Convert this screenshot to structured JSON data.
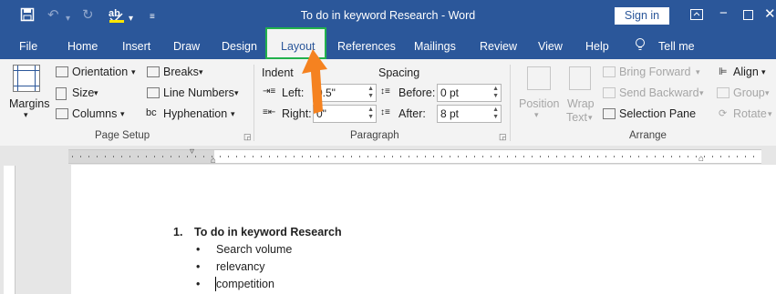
{
  "window": {
    "title": "To do in keyword Research  -  Word",
    "signin_label": "Sign in"
  },
  "tabs": [
    "File",
    "Home",
    "Insert",
    "Draw",
    "Design",
    "Layout",
    "References",
    "Mailings",
    "Review",
    "View",
    "Help",
    "Tell me"
  ],
  "active_tab": "Layout",
  "page_setup": {
    "margins": "Margins",
    "orientation": "Orientation",
    "size": "Size",
    "columns": "Columns",
    "breaks": "Breaks",
    "line_numbers": "Line Numbers",
    "hyphenation": "Hyphenation",
    "group_label": "Page Setup"
  },
  "paragraph": {
    "indent_label": "Indent",
    "spacing_label": "Spacing",
    "left_label": "Left:",
    "left_value": "0.5\"",
    "right_label": "Right:",
    "right_value": "0\"",
    "before_label": "Before:",
    "before_value": "0 pt",
    "after_label": "After:",
    "after_value": "8 pt",
    "group_label": "Paragraph"
  },
  "arrange": {
    "position": "Position",
    "wrap_text_1": "Wrap",
    "wrap_text_2": "Text",
    "bring_forward": "Bring Forward",
    "send_backward": "Send Backward",
    "selection_pane": "Selection Pane",
    "align": "Align",
    "group": "Group",
    "rotate": "Rotate",
    "group_label": "Arrange"
  },
  "document": {
    "list_number": "1.",
    "heading": "To do in keyword Research",
    "bullets": [
      "Search volume",
      "relevancy",
      "competition"
    ]
  },
  "colors": {
    "titlebar": "#2b579a",
    "highlight_border": "#22b14c",
    "arrow": "#f58220"
  },
  "icons": [
    "save-icon",
    "undo-icon",
    "redo-icon",
    "spelling-icon",
    "customize-icon",
    "ribbon-display-icon",
    "minimize-icon",
    "maximize-icon",
    "close-icon",
    "lightbulb-icon"
  ]
}
